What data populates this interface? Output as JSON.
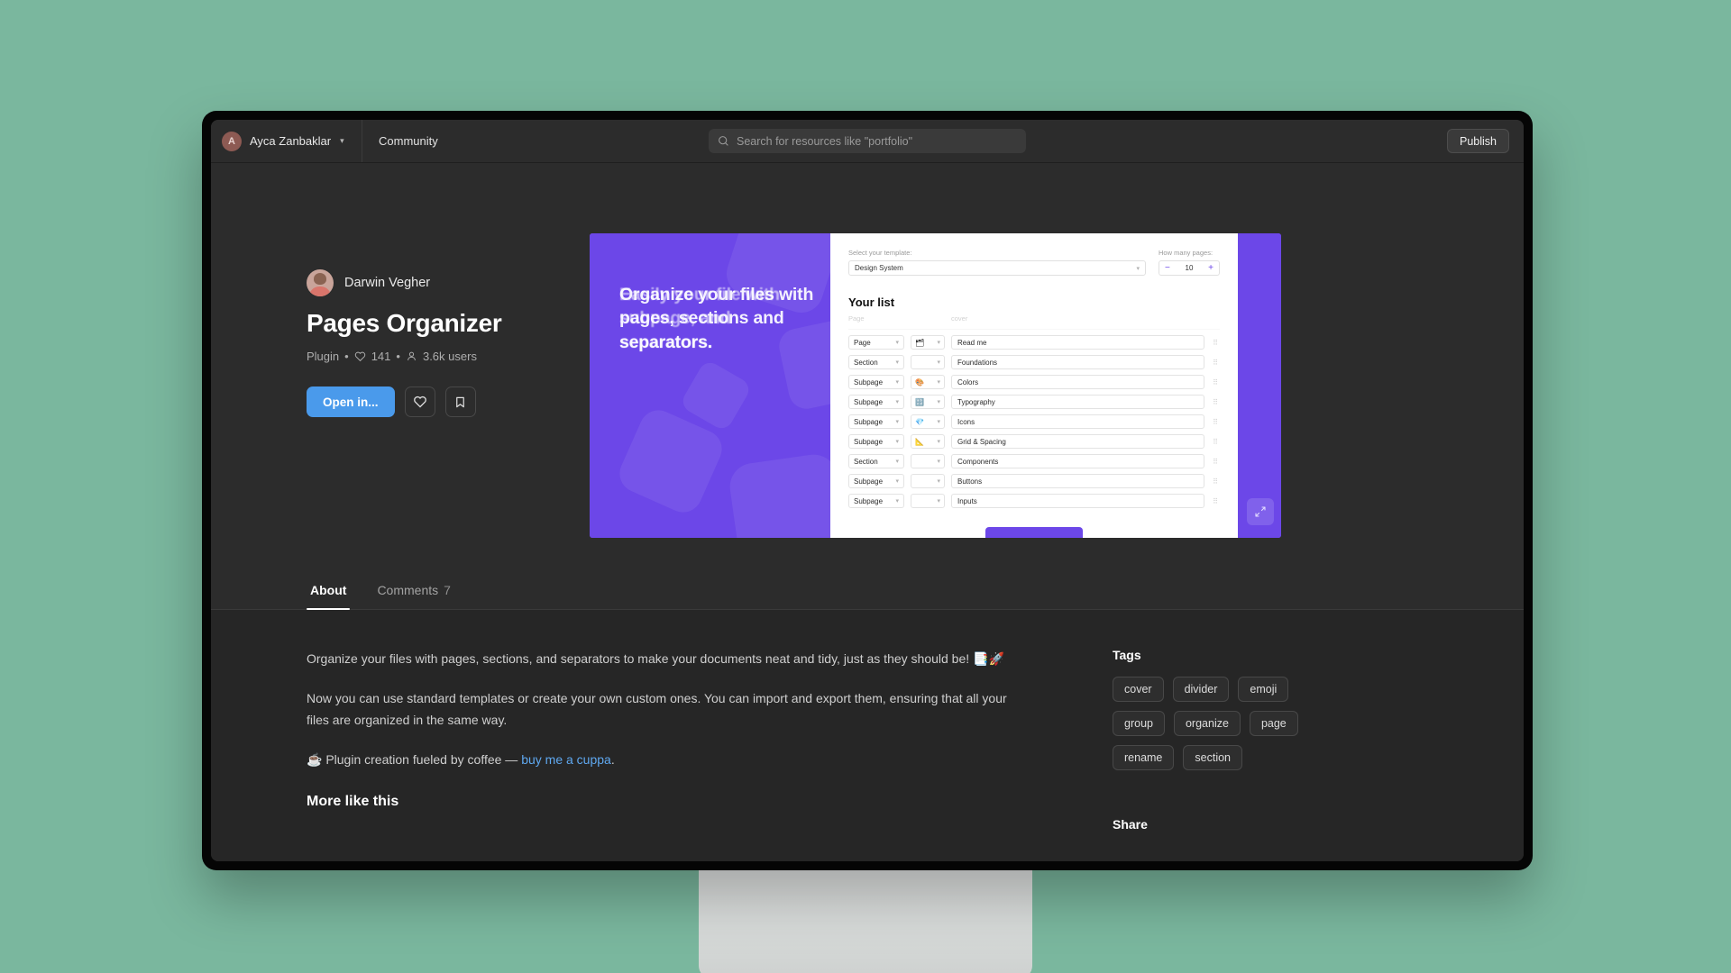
{
  "topbar": {
    "avatar_initial": "A",
    "user_name": "Ayca Zanbaklar",
    "community_label": "Community",
    "search_placeholder": "Search for resources like \"portfolio\"",
    "publish_label": "Publish"
  },
  "hero": {
    "author_name": "Darwin Vegher",
    "title": "Pages Organizer",
    "meta_type": "Plugin",
    "meta_sep": "•",
    "meta_likes": "141",
    "meta_users": "3.6k users",
    "open_button": "Open in...",
    "like_button_name": "heart",
    "save_button_name": "bookmark"
  },
  "artwork": {
    "headline": "Organize your files with pages, sections and separators.",
    "headline_ghost": "Easily your file with subpage, and separators.",
    "template_label": "Select your template:",
    "template_value": "Design System",
    "pages_label": "How many pages:",
    "pages_value": "10",
    "minus": "−",
    "plus": "+",
    "list_title": "Your list",
    "head_type": "Page",
    "head_emoji": "",
    "head_name": "cover",
    "rows": [
      {
        "type": "Page",
        "emoji": "🗂",
        "name": "Read me"
      },
      {
        "type": "Section",
        "emoji": "",
        "name": "Foundations"
      },
      {
        "type": "Subpage",
        "emoji": "🎨",
        "name": "Colors"
      },
      {
        "type": "Subpage",
        "emoji": "🔡",
        "name": "Typography"
      },
      {
        "type": "Subpage",
        "emoji": "💎",
        "name": "Icons"
      },
      {
        "type": "Subpage",
        "emoji": "📐",
        "name": "Grid & Spacing"
      },
      {
        "type": "Section",
        "emoji": "",
        "name": "Components"
      },
      {
        "type": "Subpage",
        "emoji": "",
        "name": "Buttons"
      },
      {
        "type": "Subpage",
        "emoji": "",
        "name": "Inputs"
      }
    ]
  },
  "tabs": {
    "about": "About",
    "comments": "Comments",
    "comments_count": "7"
  },
  "about": {
    "para1": "Organize your files with pages, sections, and separators to make your documents neat and tidy, just as they should be! 📑🚀",
    "para2": "Now you can use standard templates or create your own custom ones. You can import and export them, ensuring that all your files are organized in the same way.",
    "coffee_prefix": "☕ Plugin creation fueled by coffee — ",
    "coffee_link": "buy me a cuppa",
    "coffee_suffix": ".",
    "more_like_this": "More like this"
  },
  "sidebar": {
    "tags_heading": "Tags",
    "tags": [
      "cover",
      "divider",
      "emoji",
      "group",
      "organize",
      "page",
      "rename",
      "section"
    ],
    "share_heading": "Share"
  },
  "colors": {
    "page_bg": "#7ab79e",
    "app_bg": "#262626",
    "panel_bg": "#2c2c2c",
    "accent_blue": "#4a9aeb",
    "brand_purple": "#6c47e8",
    "link_blue": "#5fa8f0"
  }
}
